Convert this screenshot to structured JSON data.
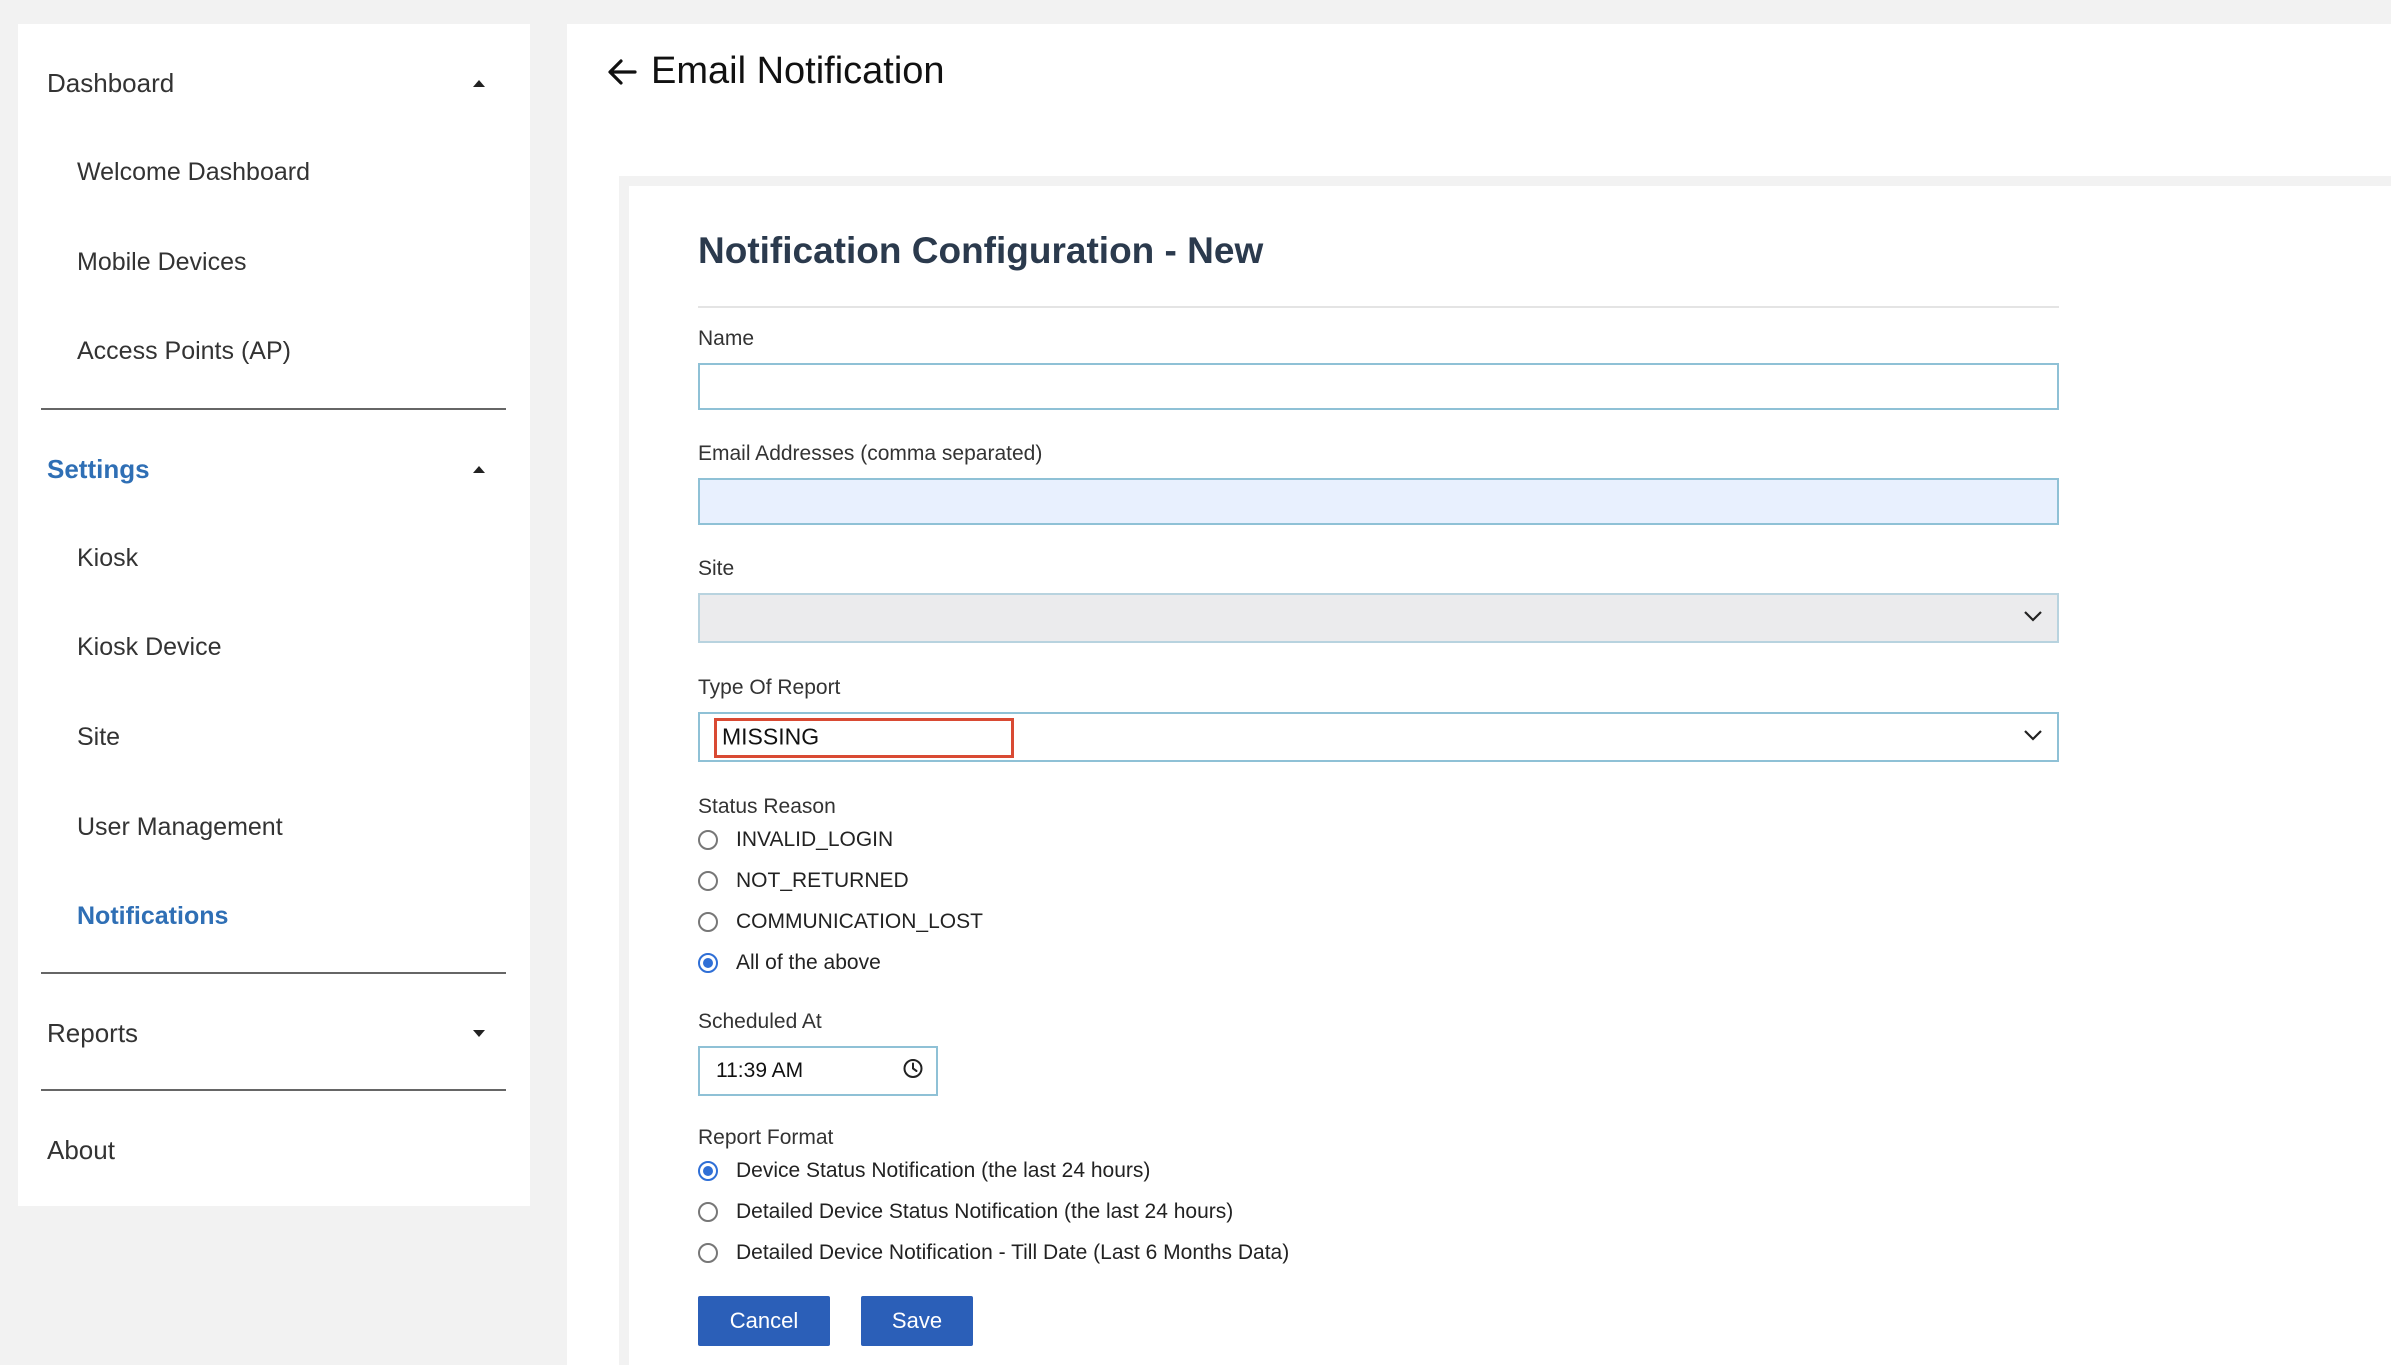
{
  "sidebar": {
    "sections": [
      {
        "label": "Dashboard",
        "items": [
          "Welcome Dashboard",
          "Mobile Devices",
          "Access Points (AP)"
        ]
      },
      {
        "label": "Settings",
        "items": [
          "Kiosk",
          "Kiosk Device",
          "Site",
          "User Management",
          "Notifications"
        ]
      },
      {
        "label": "Reports",
        "items": []
      },
      {
        "label": "About",
        "items": []
      }
    ],
    "active_section": "Settings",
    "active_item": "Notifications"
  },
  "header": {
    "title": "Email Notification"
  },
  "form": {
    "title": "Notification Configuration - New",
    "name": {
      "label": "Name",
      "value": ""
    },
    "email": {
      "label": "Email Addresses (comma separated)",
      "value": ""
    },
    "site": {
      "label": "Site",
      "value": ""
    },
    "report_type": {
      "label": "Type Of Report",
      "value": "MISSING"
    },
    "status_reason": {
      "label": "Status Reason",
      "options": [
        "INVALID_LOGIN",
        "NOT_RETURNED",
        "COMMUNICATION_LOST",
        "All of the above"
      ],
      "selected": "All of the above"
    },
    "scheduled": {
      "label": "Scheduled At",
      "value": "11:39  AM"
    },
    "report_format": {
      "label": "Report Format",
      "options": [
        "Device Status Notification (the last 24 hours)",
        "Detailed Device Status Notification (the last 24 hours)",
        "Detailed Device Notification - Till Date (Last 6 Months Data)"
      ],
      "selected": "Device Status Notification (the last 24 hours)"
    },
    "buttons": {
      "cancel": "Cancel",
      "save": "Save"
    }
  },
  "colors": {
    "accent": "#2f6fb5",
    "button": "#2b5fb8",
    "highlight": "#d94a33",
    "field_border": "#8fc1d6"
  }
}
